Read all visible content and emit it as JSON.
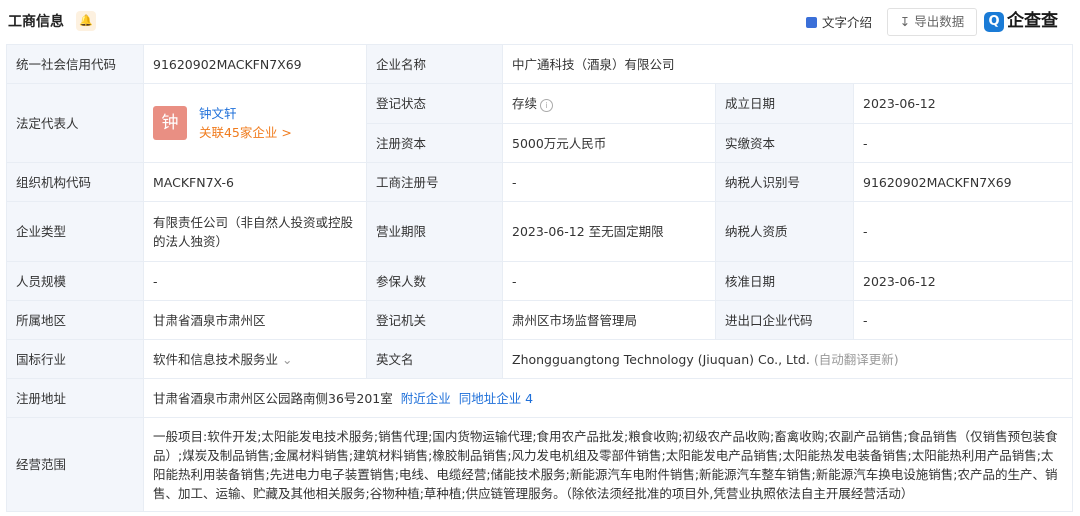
{
  "header": {
    "title": "工商信息",
    "text_intro": "文字介绍",
    "export": "导出数据",
    "logo": "企查查"
  },
  "labels": {
    "credit_code": "统一社会信用代码",
    "company_name": "企业名称",
    "legal_rep": "法定代表人",
    "reg_status": "登记状态",
    "est_date": "成立日期",
    "reg_capital": "注册资本",
    "paid_capital": "实缴资本",
    "org_code": "组织机构代码",
    "reg_no": "工商注册号",
    "taxpayer_id": "纳税人识别号",
    "company_type": "企业类型",
    "business_term": "营业期限",
    "taxpayer_qual": "纳税人资质",
    "staff_size": "人员规模",
    "insured": "参保人数",
    "approval_date": "核准日期",
    "region": "所属地区",
    "reg_authority": "登记机关",
    "import_export_code": "进出口企业代码",
    "industry": "国标行业",
    "english_name": "英文名",
    "reg_address": "注册地址",
    "business_scope": "经营范围"
  },
  "values": {
    "credit_code": "91620902MACKFN7X69",
    "company_name": "中广通科技（酒泉）有限公司",
    "legal_rep_avatar": "钟",
    "legal_rep_name": "钟文轩",
    "legal_rep_related": "关联45家企业 >",
    "reg_status": "存续",
    "est_date": "2023-06-12",
    "reg_capital": "5000万元人民币",
    "paid_capital": "-",
    "org_code": "MACKFN7X-6",
    "reg_no": "-",
    "taxpayer_id": "91620902MACKFN7X69",
    "company_type": "有限责任公司（非自然人投资或控股的法人独资）",
    "business_term": "2023-06-12 至无固定期限",
    "taxpayer_qual": "-",
    "staff_size": "-",
    "insured": "-",
    "approval_date": "2023-06-12",
    "region": "甘肃省酒泉市肃州区",
    "reg_authority": "肃州区市场监督管理局",
    "import_export_code": "-",
    "industry": "软件和信息技术服务业",
    "english_name": "Zhongguangtong Technology (Jiuquan) Co., Ltd.",
    "english_note": "(自动翻译更新)",
    "reg_address": "甘肃省酒泉市肃州区公园路南侧36号201室",
    "nearby": "附近企业",
    "same_address": "同地址企业 4",
    "business_scope": "一般项目:软件开发;太阳能发电技术服务;销售代理;国内货物运输代理;食用农产品批发;粮食收购;初级农产品收购;畜禽收购;农副产品销售;食品销售（仅销售预包装食品）;煤炭及制品销售;金属材料销售;建筑材料销售;橡胶制品销售;风力发电机组及零部件销售;太阳能发电产品销售;太阳能热发电装备销售;太阳能热利用产品销售;太阳能热利用装备销售;先进电力电子装置销售;电线、电缆经营;储能技术服务;新能源汽车电附件销售;新能源汽车整车销售;新能源汽车换电设施销售;农产品的生产、销售、加工、运输、贮藏及其他相关服务;谷物种植;草种植;供应链管理服务。（除依法须经批准的项目外,凭营业执照依法自主开展经营活动）"
  },
  "colors": {
    "label_bg": "#f3f6fb",
    "border": "#e8edf4",
    "link": "#1e6fd9",
    "orange": "#f07c1e",
    "avatar": "#e98f83"
  }
}
